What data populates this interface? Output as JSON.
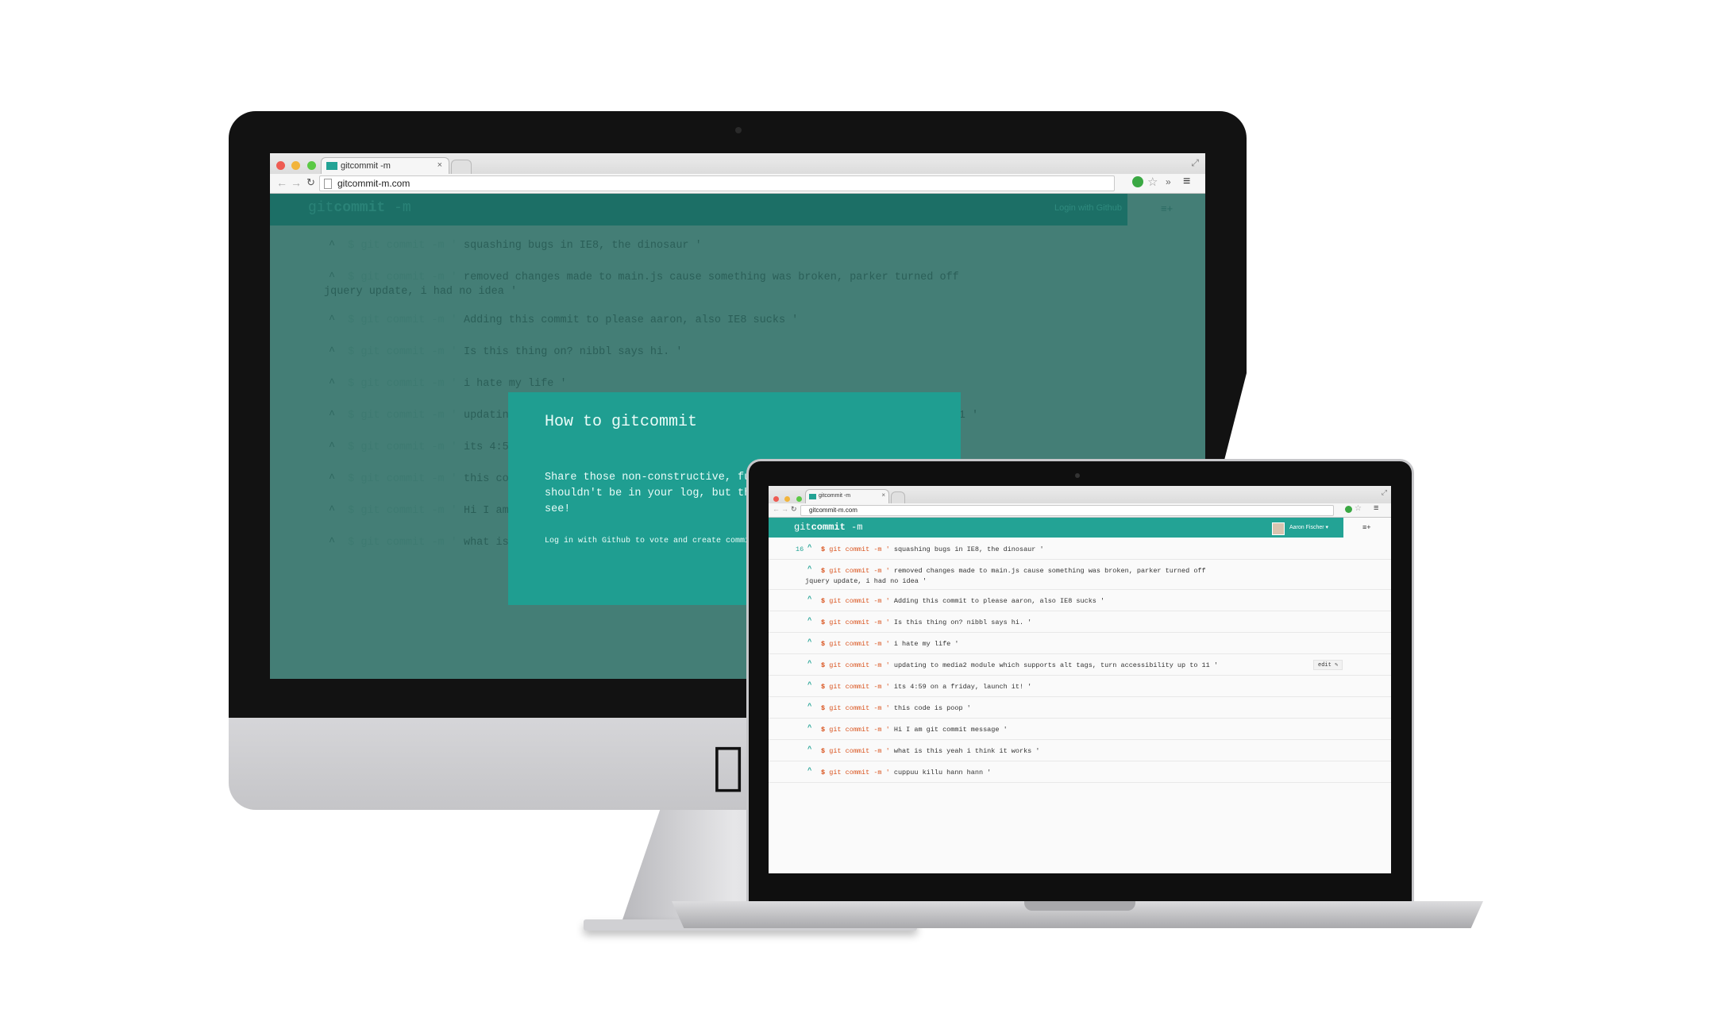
{
  "browser": {
    "tab_title": "gitcommit -m",
    "url": "gitcommit-m.com"
  },
  "site": {
    "logo_git": "git",
    "logo_commit": "commit",
    "logo_m": " -m",
    "login_label": "Login with Github",
    "menu_icon": "≡+",
    "user_name": "Aaron Fischer ▾",
    "edit_label": "edit"
  },
  "commit_prefix": {
    "dollar": "$",
    "cmd": "git commit -m",
    "quote": "'"
  },
  "desktop_commits": [
    {
      "msg": "squashing bugs in IE8, the dinosaur '"
    },
    {
      "msg": "removed changes made to main.js cause something was broken, parker turned off",
      "msg2": "jquery update, i had no idea '"
    },
    {
      "msg": "Adding this commit to please aaron, also IE8 sucks '"
    },
    {
      "msg": "Is this thing on? nibbl says hi. '"
    },
    {
      "msg": "i hate my life '"
    },
    {
      "msg": "updating to media2 module which supports alt tags, turn accessibility up to 11 '"
    },
    {
      "msg": "its 4:59 on a friday, launch it! '"
    },
    {
      "msg": "this code is poop '"
    },
    {
      "msg": "Hi I am git commit message '"
    },
    {
      "msg": "what is this yeah i think it works '"
    }
  ],
  "laptop_commits": [
    {
      "votes": "16",
      "msg": "squashing bugs in IE8, the dinosaur '"
    },
    {
      "votes": "",
      "msg": "removed changes made to main.js cause something was broken, parker turned off",
      "msg2": "jquery update, i had no idea '"
    },
    {
      "votes": "",
      "msg": "Adding this commit to please aaron, also IE8 sucks '"
    },
    {
      "votes": "",
      "msg": "Is this thing on? nibbl says hi. '"
    },
    {
      "votes": "",
      "msg": "i hate my life '"
    },
    {
      "votes": "",
      "msg": "updating to media2 module which supports alt tags, turn accessibility up to 11 '"
    },
    {
      "votes": "",
      "msg": "its 4:59 on a friday, launch it! '"
    },
    {
      "votes": "",
      "msg": "this code is poop '"
    },
    {
      "votes": "",
      "msg": "Hi I am git commit message '"
    },
    {
      "votes": "",
      "msg": "what is this yeah i think it works '"
    },
    {
      "votes": "",
      "msg": "cuppuu killu hann hann '"
    }
  ],
  "modal": {
    "title": "How to gitcommit",
    "body": "Share those non-constructive, funny commit messages. They shouldn't be in your log, but they deserve a place for all to see!",
    "footer": "Log in with Github to vote and create commit"
  },
  "colors": {
    "brand_teal": "#23a395",
    "overlay_teal": "#447e76",
    "accent_orange": "#d9531e"
  }
}
